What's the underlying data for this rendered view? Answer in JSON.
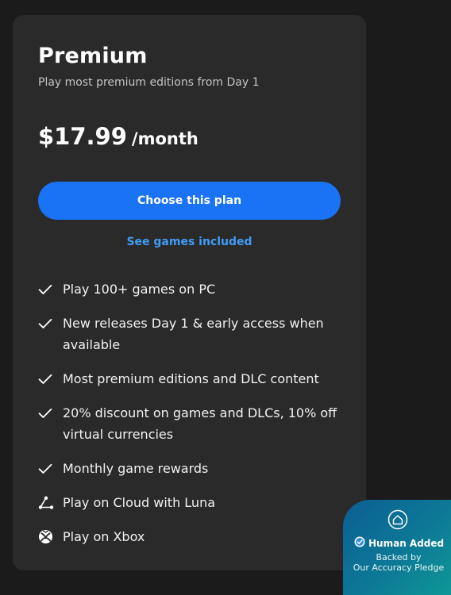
{
  "plan": {
    "title": "Premium",
    "subtitle": "Play most premium editions from Day 1",
    "price": "$17.99",
    "period": "/month",
    "choose_label": "Choose this plan",
    "see_games_label": "See games included"
  },
  "features": [
    {
      "icon": "check-icon",
      "line1": "Play 100+ games on PC"
    },
    {
      "icon": "check-icon",
      "line1": "New releases Day 1 & early access when",
      "line2": "available"
    },
    {
      "icon": "check-icon",
      "line1": "Most premium editions and DLC content"
    },
    {
      "icon": "check-icon",
      "line1": "20% discount on games and DLCs, 10% off",
      "line2": "virtual currencies"
    },
    {
      "icon": "check-icon",
      "line1": "Monthly game rewards"
    },
    {
      "icon": "luna-icon",
      "line1": "Play on Cloud with Luna"
    },
    {
      "icon": "xbox-icon",
      "line1": "Play on Xbox"
    }
  ],
  "badge": {
    "title": "Human Added",
    "line1": "Backed by",
    "line2": "Our Accuracy Pledge"
  },
  "colors": {
    "background": "#1b1b1b",
    "card": "#2a2a2b",
    "accent_button": "#1a72f5",
    "link": "#3f9cf5",
    "badge_start": "#0c5e94",
    "badge_end": "#0f9b96"
  }
}
